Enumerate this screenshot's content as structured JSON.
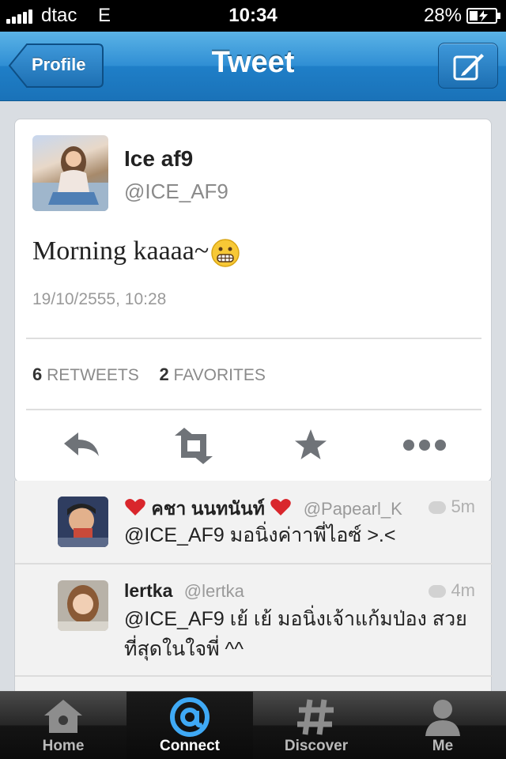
{
  "status_bar": {
    "carrier": "dtac",
    "network": "E",
    "time": "10:34",
    "battery": "28%"
  },
  "nav": {
    "back_label": "Profile",
    "title": "Tweet",
    "compose_icon": "compose-icon"
  },
  "tweet": {
    "author_name": "Ice af9",
    "author_handle": "@ICE_AF9",
    "text": "Morning kaaaa~",
    "emoji": "grimacing-face",
    "timestamp": "19/10/2555, 10:28",
    "retweets_count": "6",
    "retweets_label": "RETWEETS",
    "favorites_count": "2",
    "favorites_label": "FAVORITES"
  },
  "actions": [
    "reply-icon",
    "retweet-icon",
    "favorite-icon",
    "more-icon"
  ],
  "replies": [
    {
      "name": "คชา นนทนันท์",
      "handle": "@Papearl_K",
      "time": "5m",
      "text": "@ICE_AF9 มอนิ่งค่าาพี่ไอซ์ >.<"
    },
    {
      "name": "lertka",
      "handle": "@lertka",
      "time": "4m",
      "text": "@ICE_AF9 เย้ เย้ มอนิ่งเจ้าแก้มป่อง สวยที่สุดในใจพี่ ^^"
    }
  ],
  "tabs": [
    {
      "label": "Home",
      "icon": "home-icon"
    },
    {
      "label": "Connect",
      "icon": "at-icon"
    },
    {
      "label": "Discover",
      "icon": "hashtag-icon"
    },
    {
      "label": "Me",
      "icon": "person-icon"
    }
  ],
  "colors": {
    "nav_blue": "#1f7fc8",
    "active_tab": "#3fa9f5",
    "heart": "#d9262c"
  }
}
